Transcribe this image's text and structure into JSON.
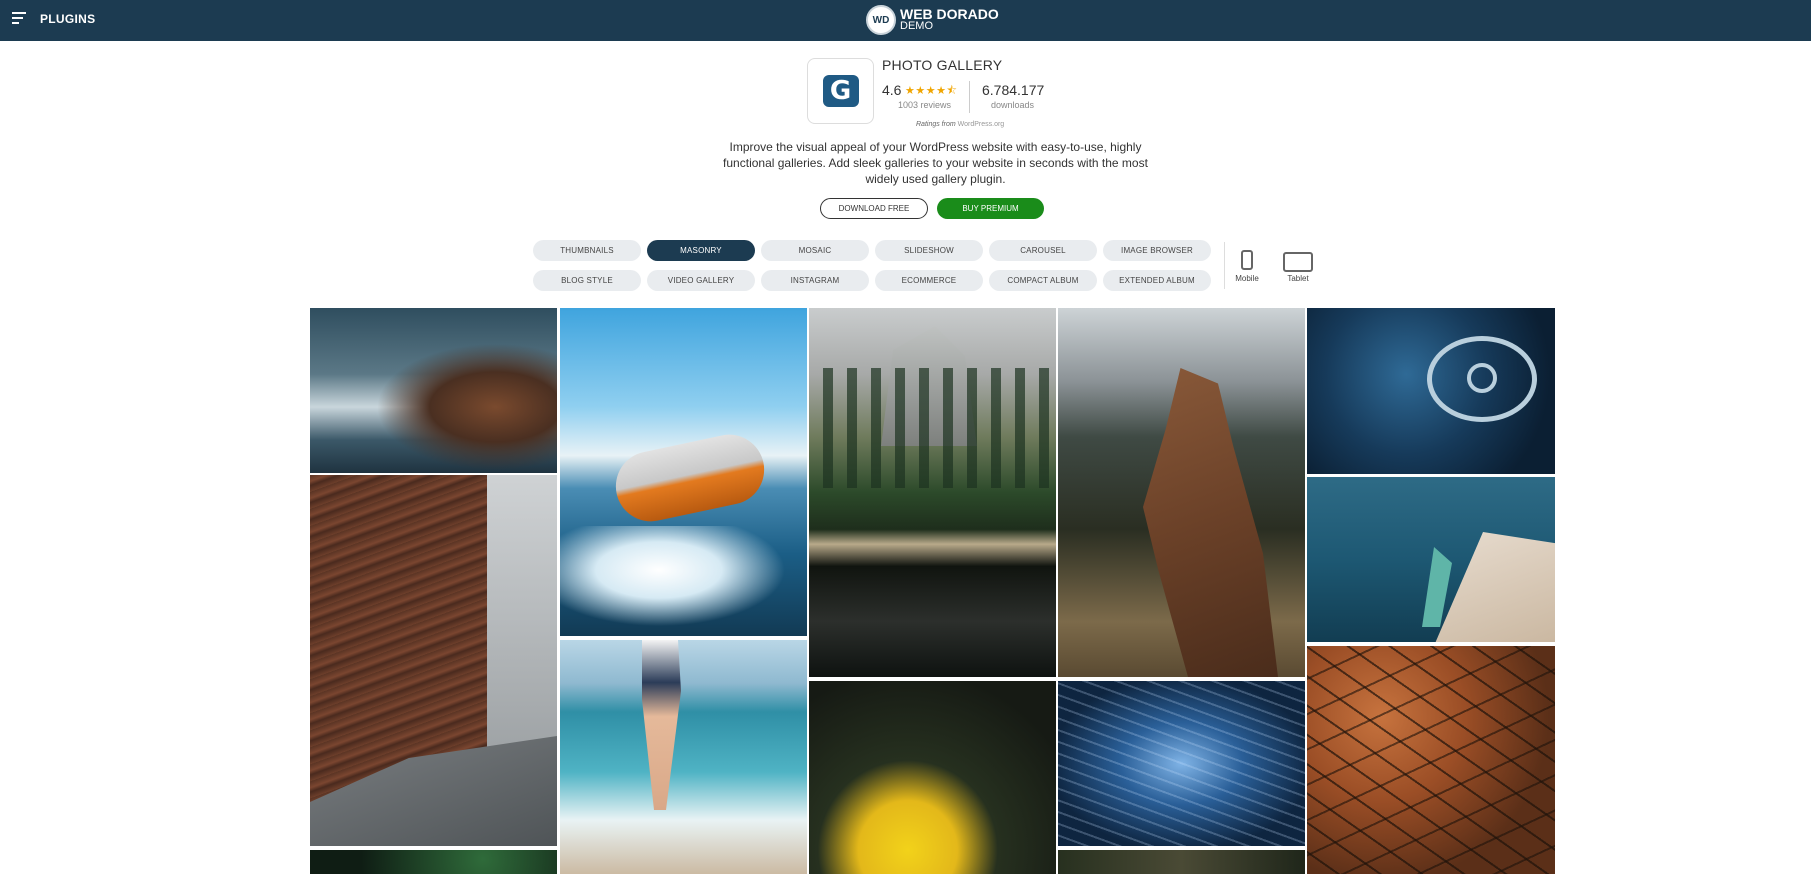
{
  "header": {
    "menu_icon": "hamburger-menu-icon",
    "plugins_label": "PLUGINS",
    "brand_logo_text": "WD",
    "brand_name": "WEB DORADO",
    "brand_sub": "DEMO"
  },
  "plugin": {
    "title": "PHOTO GALLERY",
    "icon": "photo-gallery-logo-icon",
    "icon_letter": "G",
    "rating": "4.6",
    "stars": "★★★★⯪",
    "reviews": "1003 reviews",
    "downloads": "6.784.177",
    "downloads_label": "downloads",
    "ratings_from_prefix": "Ratings from",
    "ratings_source": "WordPress.org",
    "description": "Improve the visual appeal of your WordPress website with easy-to-use, highly functional galleries. Add sleek galleries to your website in seconds with the most widely used gallery plugin.",
    "download_free_label": "DOWNLOAD FREE",
    "buy_premium_label": "BUY PREMIUM"
  },
  "views": {
    "active": "MASONRY",
    "row1": [
      "THUMBNAILS",
      "MASONRY",
      "MOSAIC",
      "SLIDESHOW",
      "CAROUSEL",
      "IMAGE BROWSER"
    ],
    "row2": [
      "BLOG STYLE",
      "VIDEO GALLERY",
      "INSTAGRAM",
      "ECOMMERCE",
      "COMPACT ALBUM",
      "EXTENDED ALBUM"
    ]
  },
  "devices": {
    "mobile_label": "Mobile",
    "tablet_label": "Tablet"
  },
  "gallery": {
    "images": [
      "ocean-waves-rocks-photo",
      "lake-reflection-building-photo",
      "dark-forest-photo",
      "man-on-inflatable-boat-photo",
      "woman-running-in-surf-photo",
      "yosemite-valley-reflection-photo",
      "yellow-flower-photo",
      "brown-horse-portrait-photo",
      "blue-water-texture-photo",
      "vintage-car-steering-wheel-photo",
      "boat-bow-on-water-photo",
      "autumn-tree-branches-photo"
    ]
  },
  "colors": {
    "header_bg": "#1c3b51",
    "active_tab": "#1c3b51",
    "premium_button": "#1a8c1a",
    "stars": "#f0a500"
  }
}
